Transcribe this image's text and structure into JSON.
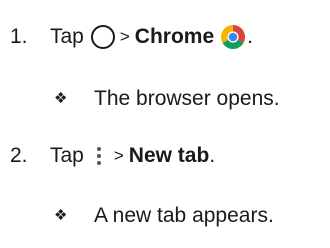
{
  "steps": [
    {
      "number": "1.",
      "tap_label": "Tap",
      "first_icon": "home-circle-icon",
      "separator": ">",
      "target_label": "Chrome",
      "target_icon": "chrome-icon",
      "end_punct": ".",
      "result_bullet": "❖",
      "result_text": "The browser opens."
    },
    {
      "number": "2.",
      "tap_label": "Tap",
      "first_icon": "more-options-icon",
      "separator": ">",
      "target_label": "New tab",
      "end_punct": ".",
      "result_bullet": "❖",
      "result_text": "A new tab appears."
    }
  ],
  "colors": {
    "text": "#1a1a1a",
    "chrome_red": "#DB4437",
    "chrome_yellow": "#F4B400",
    "chrome_green": "#0F9D58",
    "chrome_blue": "#4285F4"
  }
}
